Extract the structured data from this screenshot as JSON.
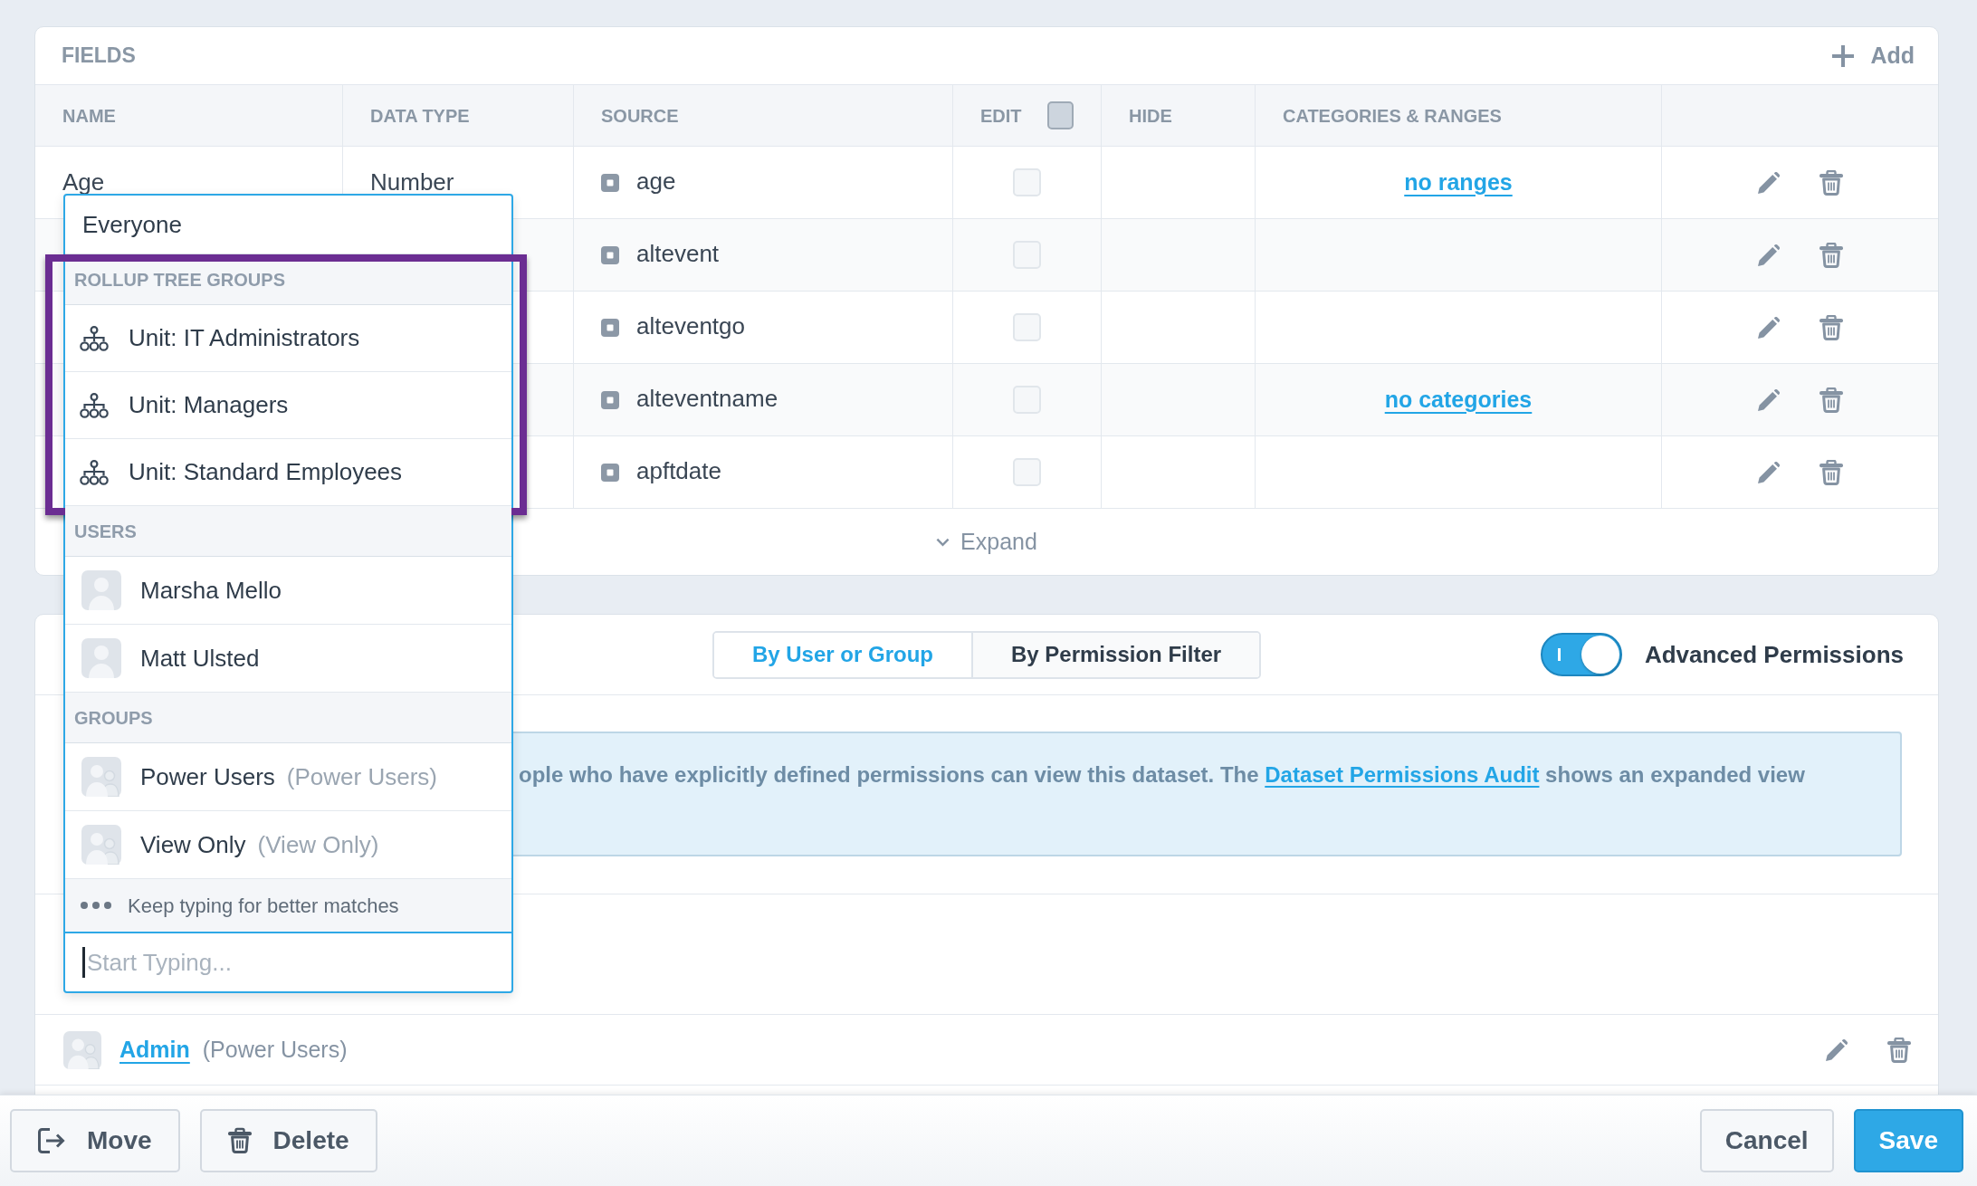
{
  "fields_panel": {
    "title": "FIELDS",
    "add_button": "Add",
    "columns": [
      "NAME",
      "DATA TYPE",
      "SOURCE",
      "EDIT",
      "HIDE",
      "CATEGORIES & RANGES"
    ],
    "edit_all": {
      "checked": false
    },
    "rows": [
      {
        "name": "Age",
        "data_type": "Number",
        "source": "age",
        "edit": false,
        "categories": "no ranges"
      },
      {
        "source": "altevent",
        "edit": false
      },
      {
        "source": "alteventgo",
        "edit": false
      },
      {
        "source": "alteventname",
        "edit": false,
        "categories": "no categories"
      },
      {
        "source": "apftdate",
        "edit": false
      }
    ],
    "expand": "Expand"
  },
  "permissions_panel": {
    "tabs": [
      {
        "label": "By User or Group",
        "selected": true
      },
      {
        "label": "By Permission Filter",
        "selected": false
      }
    ],
    "advanced_permissions": {
      "label": "Advanced Permissions",
      "on": true
    },
    "notice": {
      "before": "ople who have explicitly defined permissions can view this dataset. The ",
      "link": "Dataset Permissions Audit",
      "after": " shows an expanded view"
    },
    "entries": [
      {
        "kind": "group",
        "name": "Admin",
        "detail": "(Power Users)"
      }
    ]
  },
  "picker": {
    "everyone": "Everyone",
    "sections": [
      {
        "title": "ROLLUP TREE GROUPS",
        "kind": "unit",
        "highlighted": true,
        "items": [
          {
            "label": "Unit: IT Administrators"
          },
          {
            "label": "Unit: Managers"
          },
          {
            "label": "Unit: Standard Employees"
          }
        ]
      },
      {
        "title": "USERS",
        "kind": "user",
        "highlighted": false,
        "items": [
          {
            "label": "Marsha Mello"
          },
          {
            "label": "Matt Ulsted"
          }
        ]
      },
      {
        "title": "GROUPS",
        "kind": "group",
        "highlighted": false,
        "items": [
          {
            "label": "Power Users",
            "detail": "(Power Users)"
          },
          {
            "label": "View Only",
            "detail": "(View Only)"
          }
        ]
      }
    ],
    "more_hint": "Keep typing for better matches",
    "search": {
      "placeholder": "Start Typing..."
    }
  },
  "footer": {
    "left_buttons": [
      {
        "label": "Move",
        "kind": "move"
      },
      {
        "label": "Delete",
        "kind": "delete"
      }
    ],
    "right_buttons": [
      {
        "label": "Cancel",
        "kind": "plain"
      },
      {
        "label": "Save",
        "kind": "primary"
      }
    ]
  }
}
